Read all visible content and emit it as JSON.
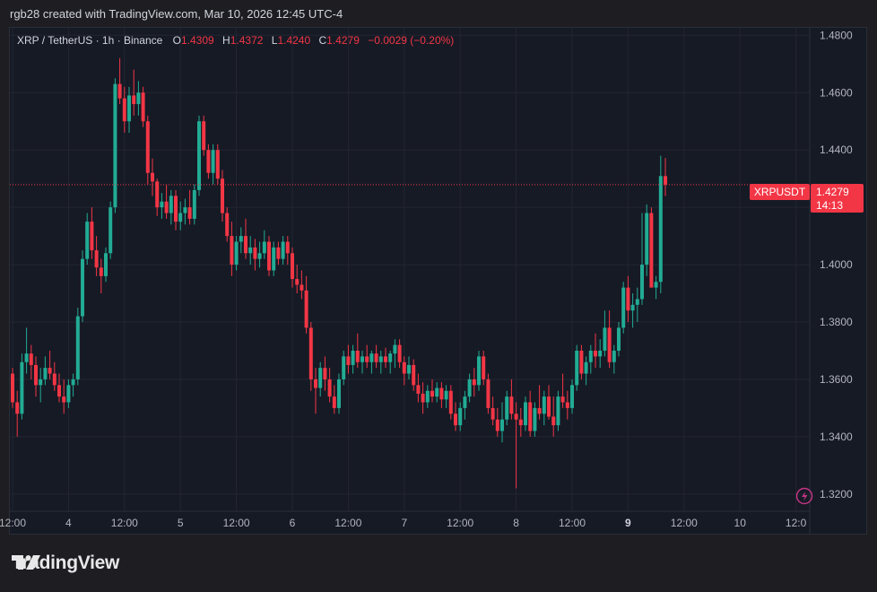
{
  "header": {
    "attribution": "rgb28 created with TradingView.com, Mar 10, 2026 12:45 UTC-4"
  },
  "legend": {
    "symbol": "XRP / TetherUS · 1h · Binance",
    "o_label": "O",
    "o_value": "1.4309",
    "h_label": "H",
    "h_value": "1.4372",
    "l_label": "L",
    "l_value": "1.4240",
    "c_label": "C",
    "c_value": "1.4279",
    "change": "−0.0029 (−0.20%)"
  },
  "price_tag": {
    "symbol": "XRPUSDT",
    "price": "1.4279",
    "countdown": "14:13"
  },
  "footer": {
    "brand": "TradingView"
  },
  "colors": {
    "up": "#22ab94",
    "down": "#f23645",
    "background": "#161a25",
    "grid": "#232632",
    "text": "#b2b5be"
  },
  "icons": {
    "flash": "lightning-icon",
    "logo": "tradingview-logo-icon"
  },
  "chart_data": {
    "type": "candlestick",
    "title": "XRP / TetherUS · 1h · Binance",
    "y_ticks": [
      "1.4800",
      "1.4600",
      "1.4400",
      "1.4200",
      "1.4000",
      "1.3800",
      "1.3600",
      "1.3400",
      "1.3200"
    ],
    "ylim": [
      1.314,
      1.4826
    ],
    "x_ticks": [
      {
        "label": "12:00",
        "index": 0,
        "bold": false
      },
      {
        "label": "4",
        "index": 12,
        "bold": false
      },
      {
        "label": "12:00",
        "index": 24,
        "bold": false
      },
      {
        "label": "5",
        "index": 36,
        "bold": false
      },
      {
        "label": "12:00",
        "index": 48,
        "bold": false
      },
      {
        "label": "6",
        "index": 60,
        "bold": false
      },
      {
        "label": "12:00",
        "index": 72,
        "bold": false
      },
      {
        "label": "7",
        "index": 84,
        "bold": false
      },
      {
        "label": "12:00",
        "index": 96,
        "bold": false
      },
      {
        "label": "8",
        "index": 108,
        "bold": false
      },
      {
        "label": "12:00",
        "index": 120,
        "bold": false
      },
      {
        "label": "9",
        "index": 132,
        "bold": true
      },
      {
        "label": "12:00",
        "index": 144,
        "bold": false
      },
      {
        "label": "10",
        "index": 156,
        "bold": false
      },
      {
        "label": "12:0",
        "index": 168,
        "bold": false
      }
    ],
    "last_price": 1.4279,
    "candles": [
      [
        1.362,
        1.364,
        1.35,
        1.352
      ],
      [
        1.352,
        1.356,
        1.34,
        1.348
      ],
      [
        1.348,
        1.369,
        1.346,
        1.366
      ],
      [
        1.366,
        1.378,
        1.362,
        1.369
      ],
      [
        1.369,
        1.372,
        1.36,
        1.365
      ],
      [
        1.365,
        1.368,
        1.354,
        1.358
      ],
      [
        1.358,
        1.364,
        1.352,
        1.36
      ],
      [
        1.36,
        1.368,
        1.358,
        1.364
      ],
      [
        1.364,
        1.37,
        1.36,
        1.362
      ],
      [
        1.362,
        1.366,
        1.356,
        1.358
      ],
      [
        1.358,
        1.362,
        1.352,
        1.354
      ],
      [
        1.354,
        1.36,
        1.348,
        1.352
      ],
      [
        1.352,
        1.36,
        1.35,
        1.358
      ],
      [
        1.358,
        1.362,
        1.354,
        1.36
      ],
      [
        1.36,
        1.385,
        1.358,
        1.382
      ],
      [
        1.382,
        1.405,
        1.38,
        1.402
      ],
      [
        1.402,
        1.418,
        1.4,
        1.415
      ],
      [
        1.415,
        1.42,
        1.402,
        1.405
      ],
      [
        1.405,
        1.41,
        1.396,
        1.399
      ],
      [
        1.399,
        1.402,
        1.39,
        1.396
      ],
      [
        1.396,
        1.406,
        1.394,
        1.404
      ],
      [
        1.404,
        1.422,
        1.402,
        1.42
      ],
      [
        1.42,
        1.465,
        1.418,
        1.463
      ],
      [
        1.463,
        1.472,
        1.456,
        1.458
      ],
      [
        1.458,
        1.462,
        1.446,
        1.45
      ],
      [
        1.45,
        1.462,
        1.446,
        1.459
      ],
      [
        1.459,
        1.468,
        1.452,
        1.456
      ],
      [
        1.456,
        1.464,
        1.452,
        1.46
      ],
      [
        1.46,
        1.462,
        1.448,
        1.45
      ],
      [
        1.45,
        1.452,
        1.428,
        1.432
      ],
      [
        1.432,
        1.437,
        1.424,
        1.429
      ],
      [
        1.429,
        1.43,
        1.417,
        1.42
      ],
      [
        1.42,
        1.425,
        1.416,
        1.422
      ],
      [
        1.422,
        1.428,
        1.416,
        1.418
      ],
      [
        1.418,
        1.426,
        1.414,
        1.424
      ],
      [
        1.424,
        1.426,
        1.412,
        1.415
      ],
      [
        1.415,
        1.422,
        1.412,
        1.418
      ],
      [
        1.418,
        1.423,
        1.414,
        1.42
      ],
      [
        1.42,
        1.426,
        1.414,
        1.416
      ],
      [
        1.416,
        1.428,
        1.414,
        1.426
      ],
      [
        1.426,
        1.452,
        1.424,
        1.45
      ],
      [
        1.45,
        1.452,
        1.438,
        1.44
      ],
      [
        1.44,
        1.442,
        1.43,
        1.432
      ],
      [
        1.432,
        1.442,
        1.428,
        1.44
      ],
      [
        1.44,
        1.442,
        1.428,
        1.43
      ],
      [
        1.43,
        1.433,
        1.415,
        1.418
      ],
      [
        1.418,
        1.42,
        1.408,
        1.41
      ],
      [
        1.41,
        1.415,
        1.396,
        1.4
      ],
      [
        1.4,
        1.41,
        1.398,
        1.408
      ],
      [
        1.408,
        1.413,
        1.404,
        1.41
      ],
      [
        1.41,
        1.416,
        1.402,
        1.404
      ],
      [
        1.404,
        1.41,
        1.4,
        1.406
      ],
      [
        1.406,
        1.409,
        1.398,
        1.402
      ],
      [
        1.402,
        1.408,
        1.399,
        1.404
      ],
      [
        1.404,
        1.412,
        1.402,
        1.408
      ],
      [
        1.408,
        1.41,
        1.396,
        1.398
      ],
      [
        1.398,
        1.408,
        1.396,
        1.406
      ],
      [
        1.406,
        1.408,
        1.4,
        1.402
      ],
      [
        1.402,
        1.41,
        1.4,
        1.408
      ],
      [
        1.408,
        1.41,
        1.4,
        1.404
      ],
      [
        1.404,
        1.406,
        1.392,
        1.395
      ],
      [
        1.395,
        1.4,
        1.39,
        1.393
      ],
      [
        1.393,
        1.398,
        1.388,
        1.391
      ],
      [
        1.391,
        1.396,
        1.376,
        1.378
      ],
      [
        1.378,
        1.38,
        1.356,
        1.36
      ],
      [
        1.36,
        1.364,
        1.348,
        1.357
      ],
      [
        1.357,
        1.366,
        1.354,
        1.364
      ],
      [
        1.364,
        1.368,
        1.356,
        1.36
      ],
      [
        1.36,
        1.364,
        1.352,
        1.354
      ],
      [
        1.354,
        1.358,
        1.348,
        1.35
      ],
      [
        1.35,
        1.362,
        1.348,
        1.36
      ],
      [
        1.36,
        1.37,
        1.358,
        1.368
      ],
      [
        1.368,
        1.372,
        1.362,
        1.365
      ],
      [
        1.365,
        1.372,
        1.362,
        1.37
      ],
      [
        1.37,
        1.376,
        1.364,
        1.366
      ],
      [
        1.366,
        1.37,
        1.362,
        1.368
      ],
      [
        1.368,
        1.372,
        1.364,
        1.366
      ],
      [
        1.366,
        1.37,
        1.362,
        1.369
      ],
      [
        1.369,
        1.372,
        1.364,
        1.366
      ],
      [
        1.366,
        1.37,
        1.362,
        1.368
      ],
      [
        1.368,
        1.371,
        1.364,
        1.366
      ],
      [
        1.366,
        1.37,
        1.362,
        1.369
      ],
      [
        1.369,
        1.374,
        1.364,
        1.372
      ],
      [
        1.372,
        1.374,
        1.364,
        1.366
      ],
      [
        1.366,
        1.368,
        1.358,
        1.362
      ],
      [
        1.362,
        1.368,
        1.36,
        1.365
      ],
      [
        1.365,
        1.367,
        1.356,
        1.358
      ],
      [
        1.358,
        1.362,
        1.352,
        1.355
      ],
      [
        1.355,
        1.359,
        1.348,
        1.352
      ],
      [
        1.352,
        1.358,
        1.35,
        1.356
      ],
      [
        1.356,
        1.36,
        1.352,
        1.354
      ],
      [
        1.354,
        1.359,
        1.352,
        1.357
      ],
      [
        1.357,
        1.359,
        1.35,
        1.353
      ],
      [
        1.353,
        1.358,
        1.35,
        1.356
      ],
      [
        1.356,
        1.358,
        1.346,
        1.348
      ],
      [
        1.348,
        1.352,
        1.342,
        1.344
      ],
      [
        1.344,
        1.352,
        1.342,
        1.35
      ],
      [
        1.35,
        1.356,
        1.346,
        1.354
      ],
      [
        1.354,
        1.362,
        1.352,
        1.36
      ],
      [
        1.36,
        1.364,
        1.354,
        1.358
      ],
      [
        1.358,
        1.37,
        1.356,
        1.368
      ],
      [
        1.368,
        1.37,
        1.358,
        1.36
      ],
      [
        1.36,
        1.362,
        1.348,
        1.35
      ],
      [
        1.35,
        1.354,
        1.344,
        1.346
      ],
      [
        1.346,
        1.35,
        1.34,
        1.342
      ],
      [
        1.342,
        1.352,
        1.338,
        1.346
      ],
      [
        1.346,
        1.356,
        1.344,
        1.354
      ],
      [
        1.354,
        1.36,
        1.346,
        1.348
      ],
      [
        1.348,
        1.352,
        1.322,
        1.346
      ],
      [
        1.346,
        1.35,
        1.34,
        1.344
      ],
      [
        1.344,
        1.354,
        1.342,
        1.352
      ],
      [
        1.352,
        1.356,
        1.34,
        1.342
      ],
      [
        1.342,
        1.352,
        1.34,
        1.35
      ],
      [
        1.35,
        1.358,
        1.346,
        1.348
      ],
      [
        1.348,
        1.356,
        1.344,
        1.354
      ],
      [
        1.354,
        1.358,
        1.346,
        1.347
      ],
      [
        1.347,
        1.354,
        1.34,
        1.344
      ],
      [
        1.344,
        1.356,
        1.342,
        1.354
      ],
      [
        1.354,
        1.362,
        1.35,
        1.352
      ],
      [
        1.352,
        1.356,
        1.346,
        1.35
      ],
      [
        1.35,
        1.36,
        1.348,
        1.358
      ],
      [
        1.358,
        1.372,
        1.356,
        1.37
      ],
      [
        1.37,
        1.372,
        1.36,
        1.362
      ],
      [
        1.362,
        1.368,
        1.358,
        1.366
      ],
      [
        1.366,
        1.372,
        1.362,
        1.37
      ],
      [
        1.37,
        1.376,
        1.364,
        1.368
      ],
      [
        1.368,
        1.374,
        1.364,
        1.37
      ],
      [
        1.37,
        1.384,
        1.368,
        1.378
      ],
      [
        1.378,
        1.384,
        1.364,
        1.366
      ],
      [
        1.366,
        1.372,
        1.362,
        1.37
      ],
      [
        1.37,
        1.38,
        1.368,
        1.378
      ],
      [
        1.378,
        1.394,
        1.376,
        1.392
      ],
      [
        1.392,
        1.396,
        1.38,
        1.384
      ],
      [
        1.384,
        1.39,
        1.378,
        1.386
      ],
      [
        1.386,
        1.392,
        1.38,
        1.388
      ],
      [
        1.388,
        1.418,
        1.386,
        1.4
      ],
      [
        1.4,
        1.421,
        1.396,
        1.418
      ],
      [
        1.418,
        1.42,
        1.4,
        1.392
      ],
      [
        1.392,
        1.396,
        1.388,
        1.394
      ],
      [
        1.394,
        1.438,
        1.39,
        1.4309
      ],
      [
        1.4309,
        1.4372,
        1.424,
        1.4279
      ]
    ]
  }
}
